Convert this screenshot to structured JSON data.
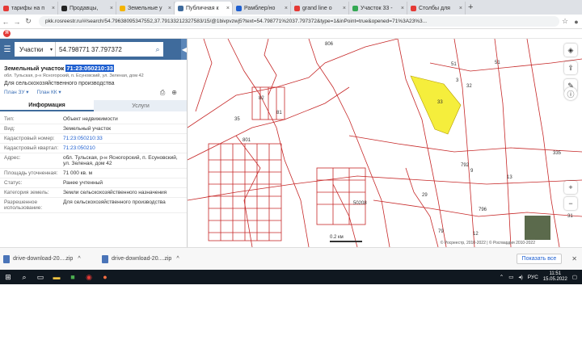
{
  "browser": {
    "tabs": [
      {
        "label": "тарифы на п",
        "color": "#e53935",
        "active": false
      },
      {
        "label": "Продавцы,",
        "color": "#222222",
        "active": false
      },
      {
        "label": "Земельные у",
        "color": "#f4b400",
        "active": false
      },
      {
        "label": "Публичная к",
        "color": "#3f6b9c",
        "active": true
      },
      {
        "label": "Рамблер/но",
        "color": "#1e5fd0",
        "active": false
      },
      {
        "label": "grand line о",
        "color": "#e53935",
        "active": false
      },
      {
        "label": "Участок 33 -",
        "color": "#34a853",
        "active": false
      },
      {
        "label": "Столбы для",
        "color": "#e53935",
        "active": false
      }
    ],
    "url": "pkk.rosreestr.ru/#/search/54.79638095347552,37.79133212327583/15/@1bivpvzwj5?text=54.798771%2037.797372&type=1&inPoint=true&opened=71%3A23%3..."
  },
  "search": {
    "type": "Участки",
    "query": "54.798771 37.797372"
  },
  "parcel": {
    "heading": "Земельный участок",
    "number": "71:23:050210:33",
    "address_small": "обл. Тульская, р-н Ясногорский, п. Есуновский, ул. Зеленая, дом 42",
    "purpose": "Для сельскохозяйственного производства",
    "plan_zu": "План ЗУ",
    "plan_kk": "План КК"
  },
  "tabs": {
    "info": "Информация",
    "services": "Услуги"
  },
  "rows": [
    {
      "k": "Тип:",
      "v": "Объект недвижимости",
      "link": false
    },
    {
      "k": "Вид:",
      "v": "Земельный участок",
      "link": false
    },
    {
      "k": "Кадастровый номер:",
      "v": "71:23:050210:33",
      "link": true
    },
    {
      "k": "Кадастровый квартал:",
      "v": "71:23:050210",
      "link": true
    },
    {
      "k": "Адрес:",
      "v": "обл. Тульская, р-н Ясногорский, п. Есуновский, ул. Зеленая, дом 42",
      "link": false
    },
    {
      "k": "Площадь уточненная:",
      "v": "71 000 кв. м",
      "link": false
    },
    {
      "k": "Статус:",
      "v": "Ранее учтенный",
      "link": false
    },
    {
      "k": "Категория земель:",
      "v": "Земли сельскохозяйственного назначения",
      "link": false
    },
    {
      "k": "Разрешенное использование:",
      "v": "Для сельскохозяйственного производства",
      "link": false
    }
  ],
  "map": {
    "labels": [
      "806",
      "51",
      "3",
      "33",
      "51",
      "35",
      "801",
      "82",
      "81",
      "32",
      "29",
      "792",
      "9",
      "796",
      "12",
      "79",
      "335",
      "13",
      "50208",
      "31"
    ],
    "scale": "0.2 км",
    "credit": "© Росреестр, 2010-2022 | © Росгвардия 2010-2022"
  },
  "downloads": [
    {
      "name": "drive-download-20....zip"
    },
    {
      "name": "drive-download-20....zip"
    }
  ],
  "downloads_showall": "Показать все",
  "taskbar": {
    "lang": "РУС",
    "time": "11:51",
    "date": "15.05.2022"
  }
}
